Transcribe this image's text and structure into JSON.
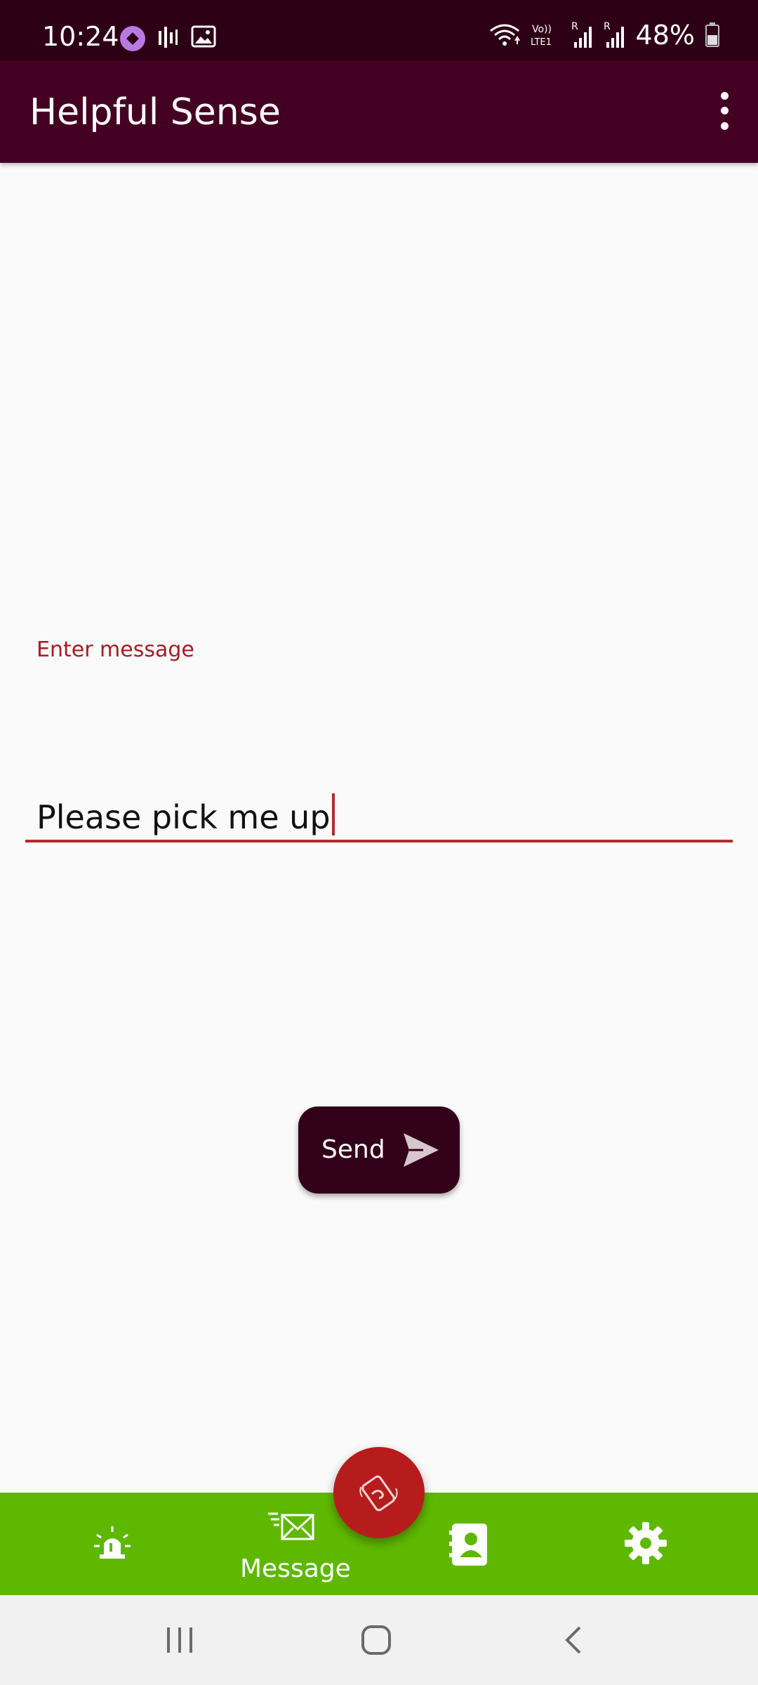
{
  "status_bar": {
    "time": "10:24",
    "battery": "48%",
    "icons": [
      "messenger-app-icon",
      "voice-app-icon",
      "gallery-icon",
      "wifi-icon",
      "volte-lte-icon",
      "signal-sim1-icon",
      "signal-sim2-icon",
      "battery-icon"
    ]
  },
  "app_bar": {
    "title": "Helpful Sense",
    "menu_icon": "more-vert-icon"
  },
  "message_form": {
    "label": "Enter message",
    "value": "Please pick me up"
  },
  "send_button": {
    "label": "Send",
    "icon": "send-icon"
  },
  "bottom_nav": {
    "items": [
      {
        "icon": "siren-alert-icon"
      },
      {
        "icon": "envelope-icon",
        "label": "Message"
      },
      {
        "icon": "contacts-book-icon"
      },
      {
        "icon": "gear-icon"
      }
    ],
    "fab_icon": "wave-hand-phone-icon"
  },
  "system_nav": {
    "icons": [
      "recent-apps-icon",
      "home-icon",
      "back-icon"
    ]
  },
  "colors": {
    "status_bar": "#2e0016",
    "app_bar": "#440022",
    "accent_red": "#b42a2e",
    "send_button": "#33001a",
    "bottom_nav": "#5fb800",
    "fab": "#b71c1c"
  }
}
